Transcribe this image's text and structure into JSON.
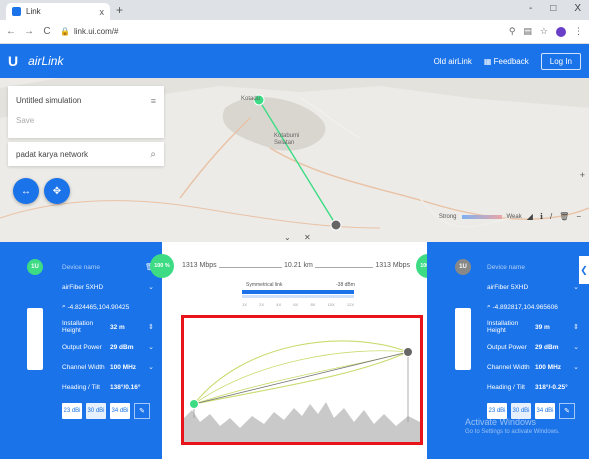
{
  "browser": {
    "tab_title": "Link",
    "tab_close": "x",
    "new_tab": "+",
    "url": "link.ui.com/#",
    "window_controls": [
      "-",
      "□",
      "X"
    ]
  },
  "app": {
    "logo_mark": "U",
    "logo_text": "airLink",
    "nav": {
      "old_airlink": "Old airLink",
      "feedback": "Feedback",
      "login": "Log In"
    }
  },
  "map": {
    "simulation_title": "Untitled simulation",
    "save_label": "Save",
    "search_value": "padat karya network",
    "place_kotadu": "Kotadu",
    "place_kotabumi": "Kotabumi\nSelatan",
    "legend_strong": "Strong",
    "legend_weak": "Weak"
  },
  "link": {
    "throughput_left": "1313 Mbps",
    "distance": "10.21 km",
    "throughput_right": "1313 Mbps",
    "left_percent": "100 %",
    "right_percent": "100 %",
    "symmetrical_label": "Symmetrical link",
    "signal_dbm": "-38 dBm",
    "scale_ticks": [
      "1X",
      "2X",
      "4X",
      "6X",
      "8X",
      "10X",
      "12X"
    ]
  },
  "device_left": {
    "badge": "1U",
    "device_name_label": "Device name",
    "device_model": "airFiber 5XHD",
    "coordinates": "-4.824465,104.90425",
    "installation_height_label": "Installation Height",
    "installation_height_value": "32 m",
    "output_power_label": "Output Power",
    "output_power_value": "29 dBm",
    "channel_width_label": "Channel Width",
    "channel_width_value": "100 MHz",
    "heading_tilt_label": "Heading / Tilt",
    "heading_tilt_value": "138°/0.16°",
    "gain_options": [
      "23 dBi",
      "30 dBi",
      "34 dBi"
    ],
    "selected_gain_index": 1
  },
  "device_right": {
    "badge": "1U",
    "device_name_label": "Device name",
    "device_model": "airFiber 5XHD",
    "coordinates": "-4.892817,104.965606",
    "installation_height_label": "Installation Height",
    "installation_height_value": "39 m",
    "output_power_label": "Output Power",
    "output_power_value": "29 dBm",
    "channel_width_label": "Channel Width",
    "channel_width_value": "100 MHz",
    "heading_tilt_label": "Heading / Tilt",
    "heading_tilt_value": "318°/-0.25°",
    "gain_options": [
      "23 dBi",
      "30 dBi",
      "34 dBi"
    ],
    "selected_gain_index": 1
  },
  "watermark": {
    "line1": "Activate Windows",
    "line2": "Go to Settings to activate Windows."
  },
  "colors": {
    "accent": "#1a73e8",
    "link_ok": "#3ddc84",
    "fresnel": "#c8dc6e",
    "highlight": "#e8141a"
  }
}
